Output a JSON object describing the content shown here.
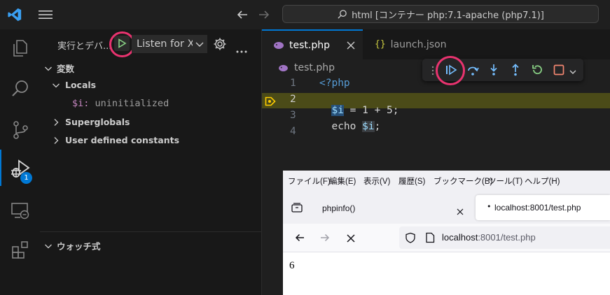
{
  "titlebar": {
    "command_center": "html [コンテナー php:7.1-apache (php7.1)]"
  },
  "activity": {
    "debug_badge": "1"
  },
  "sidebar": {
    "header": "実行とデバ...",
    "config_select": "Listen for X",
    "sections": {
      "variables": "変数",
      "locals": "Locals",
      "var_name": "$i:",
      "var_value": "uninitialized",
      "superglobals": "Superglobals",
      "user_constants": "User defined constants",
      "watch": "ウォッチ式"
    }
  },
  "editor": {
    "tabs": [
      {
        "label": "test.php",
        "active": true
      },
      {
        "label": "launch.json",
        "active": false
      }
    ],
    "breadcrumb": "test.php",
    "line_numbers": [
      "1",
      "2",
      "3",
      "4"
    ],
    "code": {
      "line1": "<?php",
      "line2_var": "$i",
      "line2_rest": " = 1 + 5;",
      "line3_kw": "echo ",
      "line3_var": "$i",
      "line3_end": ";"
    }
  },
  "browser": {
    "menu": [
      "ファイル(F)",
      "編集(E)",
      "表示(V)",
      "履歴(S)",
      "ブックマーク(B)",
      "ツール(T)",
      "ヘルプ(H)"
    ],
    "tab1": "phpinfo()",
    "tab2": "localhost:8001/test.php",
    "url_host": "localhost",
    "url_path": ":8001/test.php",
    "content": "6"
  },
  "colors": {
    "accent": "#0078d4",
    "highlight_circle": "#e8336f",
    "debug_line": "#4b4b18",
    "debug_arrow": "#ffcc00"
  }
}
